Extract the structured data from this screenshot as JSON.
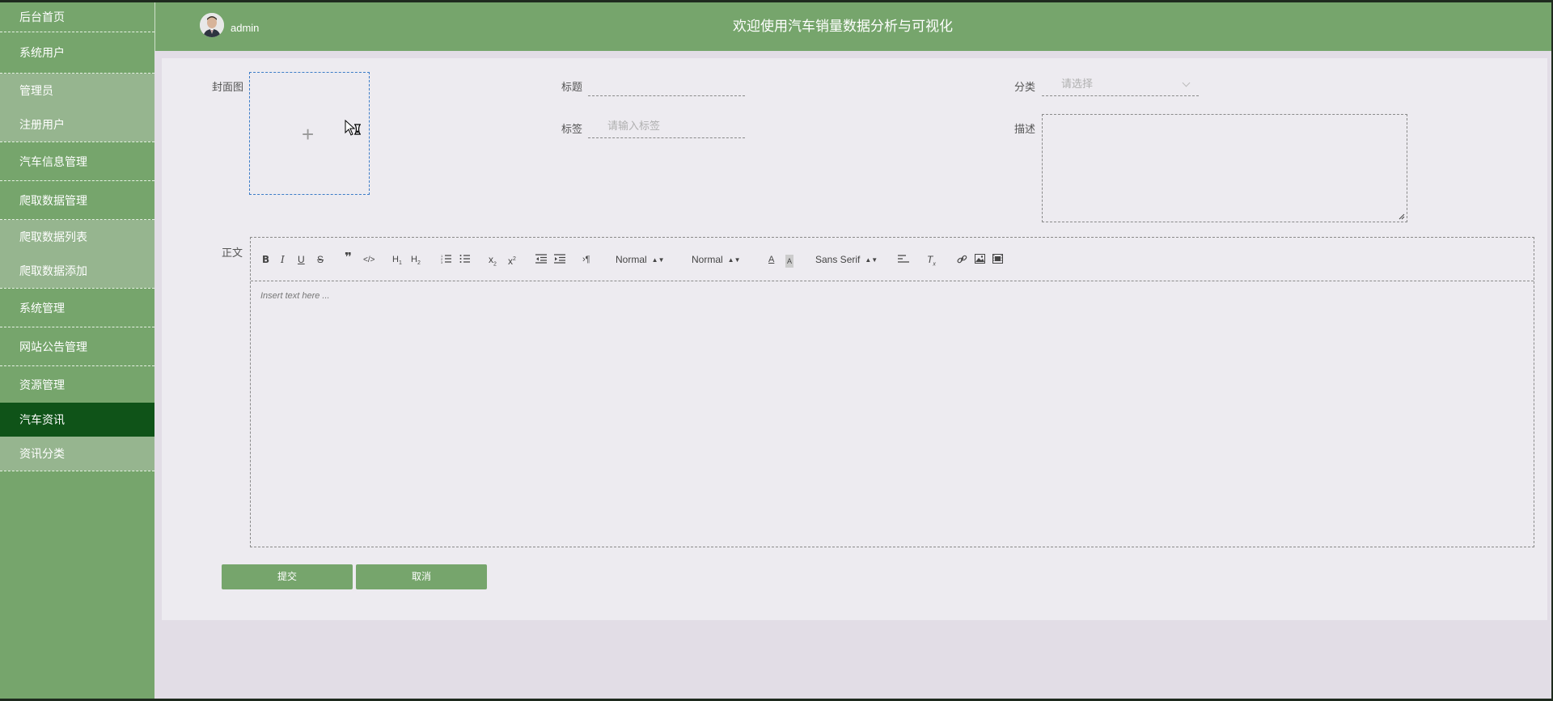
{
  "header": {
    "user": "admin",
    "title": "欢迎使用汽车销量数据分析与可视化"
  },
  "sidebar": {
    "items": [
      {
        "label": "后台首页"
      },
      {
        "label": "系统用户"
      },
      {
        "label": "管理员"
      },
      {
        "label": "注册用户"
      },
      {
        "label": "汽车信息管理"
      },
      {
        "label": "爬取数据管理"
      },
      {
        "label": "爬取数据列表"
      },
      {
        "label": "爬取数据添加"
      },
      {
        "label": "系统管理"
      },
      {
        "label": "网站公告管理"
      },
      {
        "label": "资源管理"
      },
      {
        "label": "汽车资讯"
      },
      {
        "label": "资讯分类"
      }
    ],
    "active": "汽车资讯"
  },
  "form": {
    "cover_label": "封面图",
    "title_label": "标题",
    "title_value": "",
    "category_label": "分类",
    "category_placeholder": "请选择",
    "tags_label": "标签",
    "tags_placeholder": "请输入标签",
    "desc_label": "描述",
    "body_label": "正文"
  },
  "editor": {
    "placeholder": "Insert text here ...",
    "size_select": "Normal",
    "header_select": "Normal",
    "font_select": "Sans Serif"
  },
  "buttons": {
    "submit": "提交",
    "cancel": "取消"
  },
  "colors": {
    "primary": "#76a56c",
    "active": "#0f5318",
    "sub": "#96b58f"
  }
}
